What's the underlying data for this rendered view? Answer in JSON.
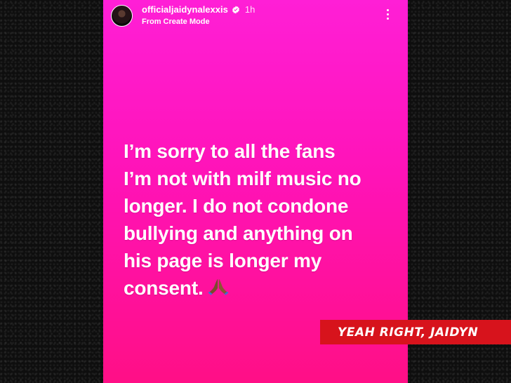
{
  "post": {
    "username": "officialjaidynalexxis",
    "verified": true,
    "time": "1h",
    "subtitle": "From Create Mode",
    "more_icon": "more-vertical-icon",
    "text_lines": [
      "I’m sorry to all the fans",
      "I’m not with milf music no",
      "longer. I do not condone",
      "bullying and anything on",
      "his page is longer my",
      "consent."
    ],
    "emoji": "folded-hands-icon"
  },
  "caption": {
    "text": "YEAH RIGHT, JAIDYN"
  },
  "colors": {
    "story_gradient_top": "#ff1fd6",
    "story_gradient_bottom": "#ff0f86",
    "caption_red": "#d7131c",
    "background": "#0e0e0e"
  }
}
